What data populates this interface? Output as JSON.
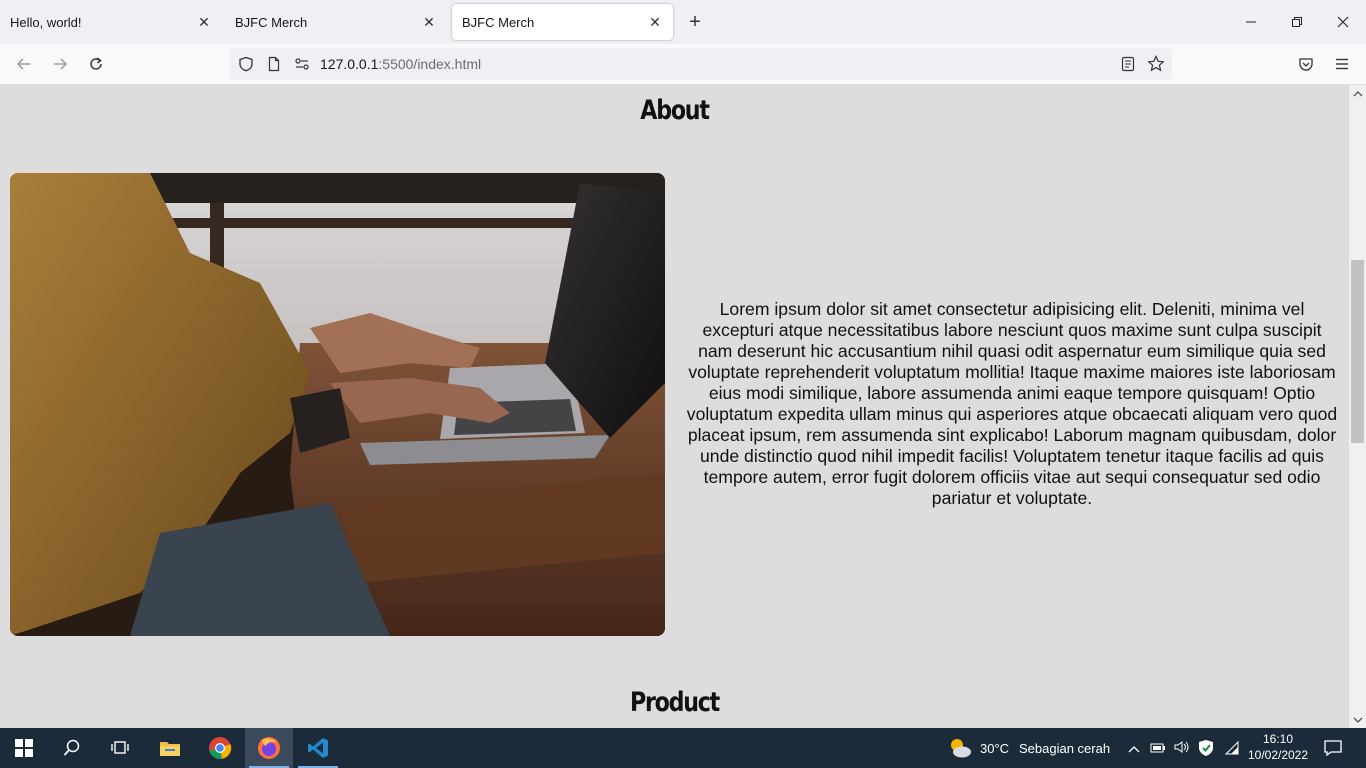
{
  "browser": {
    "tabs": [
      {
        "title": "Hello, world!",
        "active": false
      },
      {
        "title": "BJFC Merch",
        "active": false
      },
      {
        "title": "BJFC Merch",
        "active": true
      }
    ],
    "new_tab_symbol": "+",
    "url_host": "127.0.0.1",
    "url_rest": ":5500/index.html"
  },
  "page": {
    "about_heading": "About",
    "about_paragraph": "Lorem ipsum dolor sit amet consectetur adipisicing elit. Deleniti, minima vel excepturi atque necessitatibus labore nesciunt quos maxime sunt culpa suscipit nam deserunt hic accusantium nihil quasi odit aspernatur eum similique quia sed voluptate reprehenderit voluptatum mollitia! Itaque maxime maiores iste laboriosam eius modi similique, labore assumenda animi eaque tempore quisquam! Optio voluptatum expedita ullam minus qui asperiores atque obcaecati aliquam vero quod placeat ipsum, rem assumenda sint explicabo! Laborum magnam quibusdam, dolor unde distinctio quod nihil impedit facilis! Voluptatem tenetur itaque facilis ad quis tempore autem, error fugit dolorem officiis vitae aut sequi consequatur sed odio pariatur et voluptate.",
    "product_heading": "Product",
    "background_color": "#dddddd"
  },
  "taskbar": {
    "weather_temp": "30°C",
    "weather_desc": "Sebagian cerah",
    "time": "16:10",
    "date": "10/02/2022",
    "apps": [
      "start-icon",
      "search-icon",
      "task-view-icon",
      "file-explorer-icon",
      "chrome-icon",
      "firefox-icon",
      "vscode-icon"
    ]
  }
}
